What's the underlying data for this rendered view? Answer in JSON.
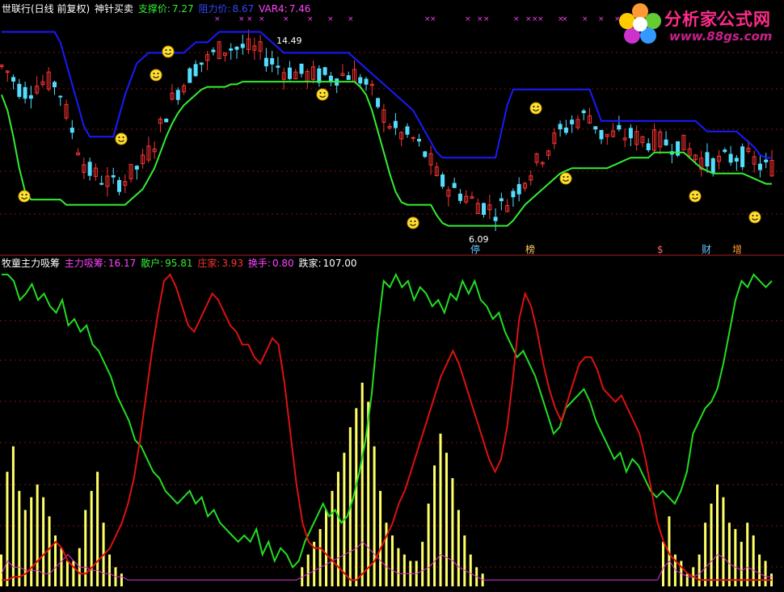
{
  "top_header": {
    "stock": "世联行(日线 前复权)",
    "indicator": "神针买卖",
    "support_label": "支撑价:",
    "support_value": "7.27",
    "resist_label": "阻力价:",
    "resist_value": "8.67",
    "var_label": "VAR4:",
    "var_value": "7.46"
  },
  "bottom_header": {
    "indicator": "牧童主力吸筹",
    "main_label": "主力吸筹:",
    "main_value": "16.17",
    "retail_label": "散户:",
    "retail_value": "95.81",
    "dealer_label": "庄家:",
    "dealer_value": "3.93",
    "turnover_label": "换手:",
    "turnover_value": "0.80",
    "fall_label": "跌家:",
    "fall_value": "107.00"
  },
  "logo": {
    "title": "分析家公式网",
    "url": "www.88gs.com"
  },
  "colors": {
    "background": "#000000",
    "resist_line": "#1a1aff",
    "support_line": "#33ee33",
    "up_candle": "#ff3333",
    "down_candle": "#55ddff",
    "retail_line": "#22dd22",
    "dealer_line": "#dd1111",
    "main_bars": "#ffff66",
    "turnover_line": "#dd33dd",
    "grid": "#801010"
  },
  "chart_data": [
    {
      "type": "line",
      "title": "神针买卖",
      "annotations": {
        "high": "14.49",
        "low": "6.09"
      },
      "event_markers": [
        "停",
        "榜",
        "$",
        "财",
        "增"
      ],
      "series": [
        {
          "name": "阻力价",
          "values": [
            14.4,
            14.4,
            14.4,
            14.4,
            14.4,
            14.4,
            14.4,
            14.4,
            14.4,
            14.4,
            14.0,
            13.2,
            12.4,
            11.6,
            10.8,
            10.4,
            10.4,
            10.4,
            10.4,
            10.4,
            11.2,
            12.0,
            12.6,
            13.2,
            13.4,
            13.6,
            13.6,
            13.6,
            13.6,
            13.6,
            13.6,
            13.6,
            13.8,
            14.0,
            14.0,
            14.0,
            14.2,
            14.4,
            14.4,
            14.4,
            14.4,
            14.4,
            14.4,
            14.4,
            14.4,
            14.2,
            14.0,
            13.8,
            13.6,
            13.6,
            13.6,
            13.6,
            13.6,
            13.6,
            13.6,
            13.6,
            13.6,
            13.6,
            13.6,
            13.6,
            13.4,
            13.2,
            13.0,
            12.8,
            12.6,
            12.4,
            12.2,
            12.0,
            11.8,
            11.6,
            11.4,
            11.0,
            10.6,
            10.2,
            9.8,
            9.6,
            9.6,
            9.6,
            9.6,
            9.6,
            9.6,
            9.6,
            9.6,
            9.6,
            9.6,
            10.6,
            11.6,
            12.2,
            12.2,
            12.2,
            12.2,
            12.2,
            12.2,
            12.2,
            12.2,
            12.2,
            12.2,
            12.2,
            12.2,
            12.2,
            12.2,
            11.6,
            11.0,
            11.0,
            11.0,
            11.0,
            11.0,
            11.0,
            11.0,
            11.0,
            11.0,
            11.0,
            11.0,
            11.0,
            11.0,
            11.0,
            11.0,
            11.0,
            11.0,
            10.8,
            10.6,
            10.6,
            10.6,
            10.6,
            10.6,
            10.6,
            10.4,
            10.2,
            10.0,
            9.7,
            9.6,
            9.6
          ]
        },
        {
          "name": "支撑价",
          "values": [
            12.0,
            11.4,
            10.4,
            9.2,
            8.3,
            8.0,
            8.0,
            8.0,
            8.0,
            8.0,
            8.0,
            7.8,
            7.8,
            7.8,
            7.8,
            7.8,
            7.8,
            7.8,
            7.8,
            7.8,
            7.8,
            7.8,
            8.0,
            8.2,
            8.4,
            8.8,
            9.2,
            9.8,
            10.4,
            10.9,
            11.3,
            11.6,
            11.8,
            12.0,
            12.2,
            12.3,
            12.3,
            12.3,
            12.3,
            12.4,
            12.4,
            12.5,
            12.5,
            12.5,
            12.5,
            12.5,
            12.5,
            12.5,
            12.5,
            12.5,
            12.5,
            12.5,
            12.5,
            12.5,
            12.5,
            12.5,
            12.5,
            12.5,
            12.5,
            12.5,
            12.5,
            12.3,
            12.0,
            11.4,
            10.6,
            9.8,
            9.0,
            8.3,
            7.9,
            7.8,
            7.8,
            7.8,
            7.8,
            7.8,
            7.4,
            7.1,
            7.0,
            7.0,
            7.0,
            7.0,
            7.0,
            7.0,
            7.0,
            7.0,
            7.0,
            7.0,
            7.0,
            7.2,
            7.5,
            7.8,
            8.0,
            8.2,
            8.4,
            8.6,
            8.8,
            9.0,
            9.1,
            9.2,
            9.2,
            9.2,
            9.2,
            9.2,
            9.2,
            9.2,
            9.3,
            9.4,
            9.5,
            9.6,
            9.6,
            9.6,
            9.6,
            9.8,
            9.8,
            9.8,
            9.8,
            9.8,
            9.8,
            9.6,
            9.4,
            9.2,
            9.1,
            9.0,
            9.0,
            9.0,
            9.0,
            9.0,
            9.0,
            8.9,
            8.8,
            8.7,
            8.6,
            8.6
          ]
        }
      ]
    },
    {
      "type": "line",
      "title": "牧童主力吸筹",
      "series": [
        {
          "name": "散户",
          "values": [
            98,
            98,
            96,
            90,
            92,
            95,
            90,
            92,
            88,
            86,
            90,
            82,
            84,
            80,
            82,
            76,
            74,
            70,
            66,
            60,
            56,
            52,
            46,
            44,
            40,
            36,
            34,
            30,
            28,
            26,
            28,
            30,
            26,
            28,
            22,
            24,
            20,
            18,
            16,
            14,
            16,
            14,
            18,
            10,
            14,
            8,
            12,
            10,
            6,
            8,
            14,
            18,
            22,
            26,
            22,
            24,
            20,
            22,
            28,
            36,
            46,
            60,
            80,
            96,
            94,
            98,
            94,
            96,
            90,
            94,
            92,
            88,
            90,
            86,
            92,
            90,
            96,
            92,
            96,
            90,
            88,
            84,
            86,
            80,
            76,
            72,
            74,
            70,
            66,
            60,
            54,
            48,
            50,
            56,
            58,
            60,
            62,
            58,
            52,
            48,
            44,
            40,
            42,
            36,
            40,
            38,
            34,
            30,
            28,
            30,
            28,
            26,
            30,
            36,
            48,
            52,
            56,
            58,
            62,
            70,
            80,
            90,
            96,
            94,
            98,
            96,
            94,
            96
          ],
          "range": [
            0,
            100
          ]
        },
        {
          "name": "庄家",
          "values": [
            2,
            2,
            3,
            3,
            4,
            6,
            8,
            10,
            12,
            14,
            12,
            8,
            6,
            4,
            4,
            6,
            8,
            10,
            12,
            16,
            20,
            26,
            34,
            46,
            60,
            74,
            86,
            96,
            98,
            94,
            88,
            82,
            80,
            84,
            88,
            92,
            90,
            86,
            82,
            80,
            76,
            76,
            72,
            70,
            74,
            78,
            76,
            64,
            48,
            32,
            20,
            14,
            12,
            12,
            10,
            8,
            6,
            4,
            2,
            2,
            4,
            6,
            8,
            12,
            16,
            20,
            26,
            30,
            36,
            42,
            48,
            54,
            60,
            66,
            70,
            74,
            70,
            64,
            58,
            52,
            46,
            40,
            36,
            40,
            50,
            66,
            84,
            92,
            88,
            80,
            70,
            62,
            56,
            52,
            58,
            64,
            70,
            72,
            72,
            68,
            62,
            60,
            58,
            60,
            56,
            52,
            48,
            40,
            30,
            20,
            14,
            10,
            8,
            6,
            4,
            3,
            2,
            2,
            2,
            2,
            2,
            2,
            2,
            2,
            2,
            2,
            2,
            2,
            2
          ],
          "range": [
            0,
            100
          ]
        },
        {
          "name": "主力吸筹",
          "values": [
            10,
            36,
            44,
            30,
            24,
            28,
            32,
            28,
            22,
            16,
            12,
            8,
            8,
            12,
            24,
            30,
            36,
            20,
            10,
            6,
            4,
            2,
            2,
            2,
            2,
            2,
            2,
            2,
            2,
            2,
            2,
            2,
            2,
            2,
            2,
            2,
            2,
            2,
            2,
            2,
            2,
            2,
            2,
            2,
            2,
            2,
            2,
            2,
            2,
            2,
            6,
            10,
            14,
            18,
            24,
            30,
            36,
            42,
            50,
            56,
            64,
            58,
            44,
            30,
            20,
            16,
            12,
            10,
            8,
            8,
            14,
            26,
            38,
            48,
            42,
            34,
            24,
            16,
            10,
            6,
            4,
            2,
            2,
            2,
            2,
            2,
            2,
            2,
            2,
            2,
            2,
            2,
            2,
            2,
            2,
            2,
            2,
            2,
            2,
            2,
            2,
            2,
            2,
            2,
            2,
            2,
            2,
            2,
            2,
            2,
            14,
            22,
            10,
            8,
            4,
            6,
            10,
            20,
            26,
            32,
            28,
            20,
            18,
            14,
            20,
            16,
            10,
            8,
            4
          ]
        },
        {
          "name": "换手",
          "values": [
            4,
            8,
            6,
            6,
            5,
            5,
            5,
            4,
            4,
            6,
            8,
            10,
            8,
            6,
            6,
            5,
            5,
            4,
            4,
            3,
            3,
            2,
            2,
            2,
            2,
            2,
            2,
            2,
            2,
            2,
            2,
            2,
            2,
            2,
            2,
            2,
            2,
            2,
            2,
            2,
            2,
            2,
            2,
            2,
            2,
            2,
            2,
            2,
            2,
            2,
            3,
            4,
            5,
            6,
            7,
            8,
            9,
            10,
            11,
            12,
            14,
            12,
            10,
            8,
            6,
            5,
            4,
            4,
            4,
            4,
            5,
            6,
            8,
            10,
            9,
            8,
            6,
            5,
            4,
            3,
            2,
            2,
            2,
            2,
            2,
            2,
            2,
            2,
            2,
            2,
            2,
            2,
            2,
            2,
            2,
            2,
            2,
            2,
            2,
            2,
            2,
            2,
            2,
            2,
            2,
            2,
            2,
            2,
            2,
            2,
            6,
            8,
            5,
            4,
            3,
            3,
            4,
            6,
            8,
            10,
            9,
            7,
            6,
            5,
            6,
            5,
            4,
            3,
            3
          ]
        }
      ]
    }
  ]
}
